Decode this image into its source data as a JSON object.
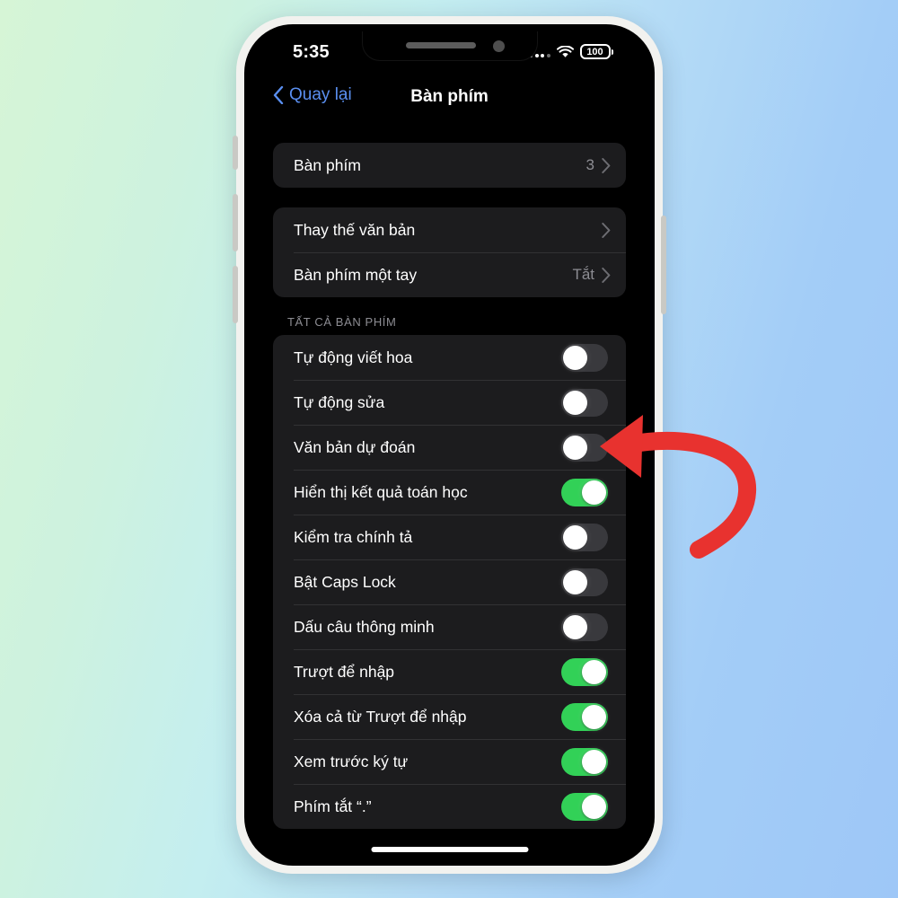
{
  "background": {
    "gradient_from": "#d6f5d6",
    "gradient_to": "#9ec7f7"
  },
  "annotation": {
    "arrow_name": "red-curved-arrow",
    "arrow_color": "#e8322f",
    "points_at": "Tự động sửa"
  },
  "status_bar": {
    "time": "5:35",
    "battery_level": "100",
    "wifi_icon": "wifi-icon",
    "signal_icon": "cellular-dots-icon"
  },
  "nav": {
    "back_label": "Quay lại",
    "back_icon": "chevron-left-icon",
    "title": "Bàn phím"
  },
  "colors": {
    "accent_blue": "#5a8ff0",
    "toggle_on": "#32d157",
    "toggle_off": "#39393d",
    "card_bg": "#1c1c1e",
    "secondary_text": "#8d8d93"
  },
  "sections": [
    {
      "header": "",
      "rows": [
        {
          "label": "Bàn phím",
          "value": "3",
          "type": "disclosure"
        }
      ]
    },
    {
      "header": "",
      "rows": [
        {
          "label": "Thay thế văn bản",
          "value": "",
          "type": "disclosure"
        },
        {
          "label": "Bàn phím một tay",
          "value": "Tắt",
          "type": "disclosure"
        }
      ]
    },
    {
      "header": "TẤT CẢ BÀN PHÍM",
      "rows": [
        {
          "label": "Tự động viết hoa",
          "type": "toggle",
          "on": false
        },
        {
          "label": "Tự động sửa",
          "type": "toggle",
          "on": false
        },
        {
          "label": "Văn bản dự đoán",
          "type": "toggle",
          "on": false
        },
        {
          "label": "Hiển thị kết quả toán học",
          "type": "toggle",
          "on": true
        },
        {
          "label": "Kiểm tra chính tả",
          "type": "toggle",
          "on": false
        },
        {
          "label": "Bật Caps Lock",
          "type": "toggle",
          "on": false
        },
        {
          "label": "Dấu câu thông minh",
          "type": "toggle",
          "on": false
        },
        {
          "label": "Trượt để nhập",
          "type": "toggle",
          "on": true
        },
        {
          "label": "Xóa cả từ Trượt để nhập",
          "type": "toggle",
          "on": true
        },
        {
          "label": "Xem trước ký tự",
          "type": "toggle",
          "on": true
        },
        {
          "label": "Phím tắt “.”",
          "type": "toggle",
          "on": true
        }
      ]
    }
  ]
}
